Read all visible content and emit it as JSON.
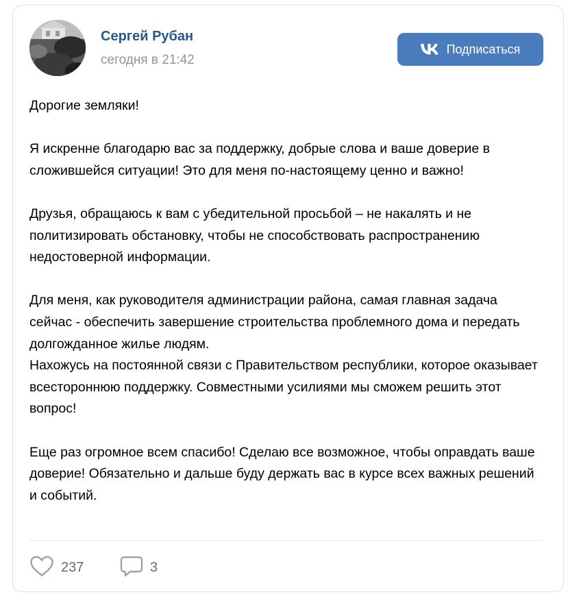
{
  "author": {
    "name": "Сергей Рубан",
    "time": "сегодня в 21:42"
  },
  "subscribe_button": {
    "label": "Подписаться",
    "icon": "vk-logo-icon",
    "color": "#4a7cbd"
  },
  "post": {
    "paragraphs": [
      [
        "Дорогие земляки!"
      ],
      [
        "Я искренне благодарю вас за поддержку, добрые слова и ваше доверие в сложившейся ситуации! Это для меня по-настоящему ценно и важно!"
      ],
      [
        "Друзья, обращаюсь к вам с убедительной просьбой – не накалять и не политизировать обстановку, чтобы не способствовать распространению недостоверной информации."
      ],
      [
        "Для меня, как руководителя администрации района, самая главная задача сейчас - обеспечить завершение строительства проблемного дома и передать долгожданное жилье людям.",
        "Нахожусь на постоянной связи с Правительством республики, которое оказывает всестороннюю поддержку. Совместными усилиями мы сможем решить этот вопрос!"
      ],
      [
        "Еще раз огромное всем спасибо! Сделаю все возможное, чтобы оправдать ваше доверие! Обязательно и дальше буду держать вас в курсе всех важных решений и событий."
      ]
    ]
  },
  "reactions": {
    "likes": {
      "icon": "heart-icon",
      "count": "237"
    },
    "comments": {
      "icon": "comment-icon",
      "count": "3"
    }
  },
  "colors": {
    "author_name": "#2a5885",
    "muted_text": "#939393",
    "reaction_text": "#626d7a",
    "card_border": "#dce1e6"
  }
}
